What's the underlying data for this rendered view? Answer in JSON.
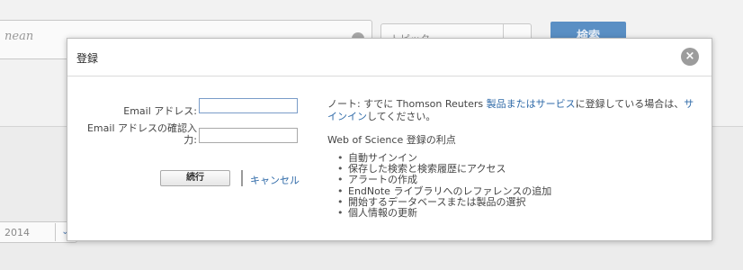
{
  "background": {
    "search_text": "nean",
    "topic_select": "トピック",
    "search_button": "検索",
    "year_value": "2014"
  },
  "modal": {
    "title": "登録",
    "close_label": "×",
    "email_label": "Email アドレス:",
    "email_value": "",
    "confirm_label": "Email アドレスの確認入力:",
    "confirm_value": "",
    "continue_button": "続行",
    "cancel_link": "キャンセル",
    "note_prefix": "ノート: すでに Thomson Reuters ",
    "note_link1": "製品またはサービス",
    "note_middle": "に登録している場合は、",
    "note_link2": "サインイン",
    "note_suffix": "してください。",
    "benefits_title": "Web of Science 登録の利点",
    "benefits": [
      "自動サインイン",
      "保存した検索と検索履歴にアクセス",
      "アラートの作成",
      "EndNote ライブラリへのレファレンスの追加",
      "開始するデータベースまたは製品の選択",
      "個人情報の更新"
    ]
  }
}
